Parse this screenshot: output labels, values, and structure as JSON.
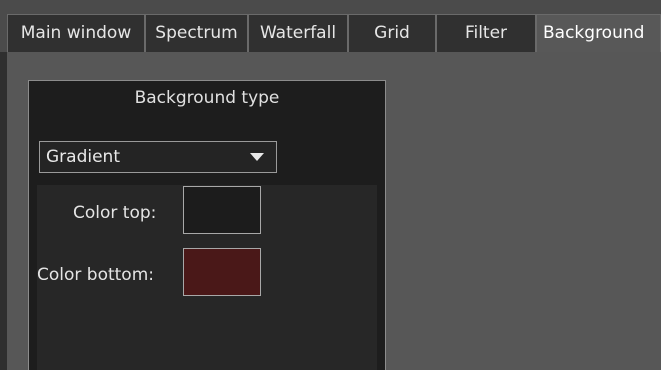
{
  "tabs": [
    {
      "label": "Main window"
    },
    {
      "label": "Spectrum"
    },
    {
      "label": "Waterfall"
    },
    {
      "label": "Grid"
    },
    {
      "label": "Filter"
    },
    {
      "label": "Background",
      "active": true
    }
  ],
  "background_group": {
    "title": "Background type",
    "type_select": {
      "value": "Gradient"
    },
    "color_top": {
      "label": "Color top:",
      "color": "#1c1c1c"
    },
    "color_bottom": {
      "label": "Color bottom:",
      "color": "#4a1818"
    }
  },
  "icons": {
    "select_arrow": "chevron-down-icon"
  }
}
